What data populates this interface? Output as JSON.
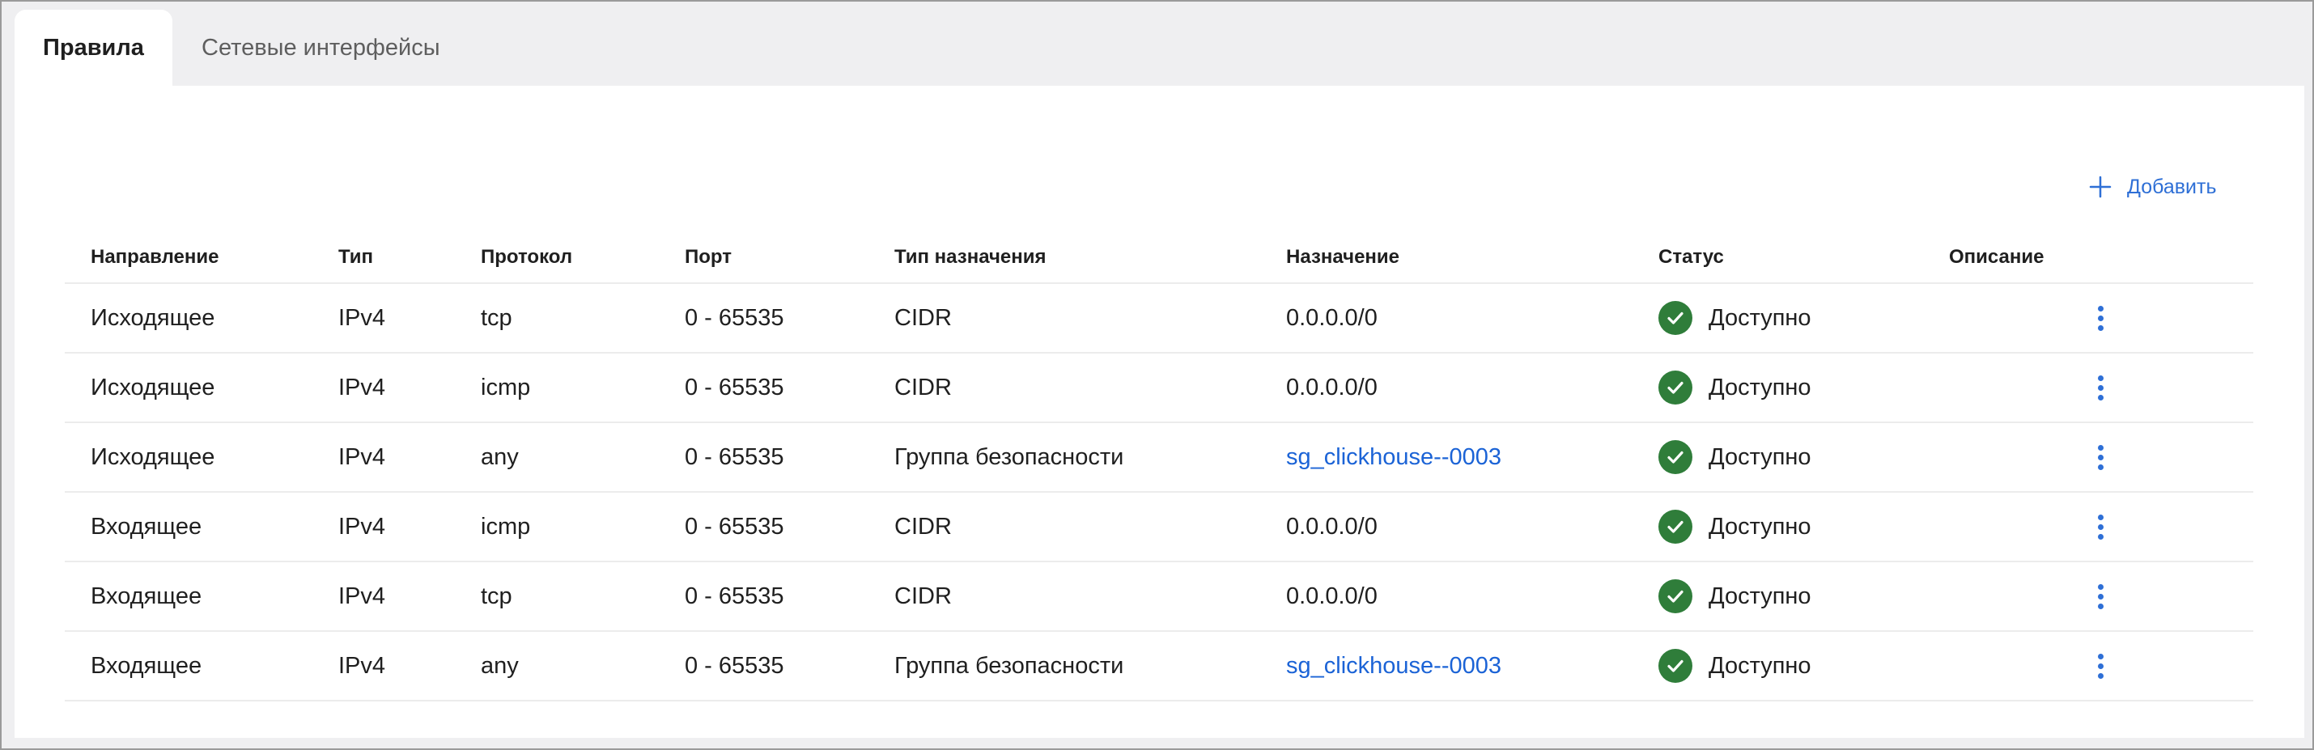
{
  "tabs": [
    {
      "label": "Правила",
      "active": true
    },
    {
      "label": "Сетевые интерфейсы",
      "active": false
    }
  ],
  "toolbar": {
    "add_label": "Добавить",
    "add_icon": "plus-icon"
  },
  "table": {
    "headers": [
      "Направление",
      "Тип",
      "Протокол",
      "Порт",
      "Тип назначения",
      "Назначение",
      "Статус",
      "Описание"
    ],
    "rows": [
      {
        "direction": "Исходящее",
        "type": "IPv4",
        "protocol": "tcp",
        "port": "0 - 65535",
        "dest_type": "CIDR",
        "dest": "0.0.0.0/0",
        "dest_is_link": false,
        "status": "Доступно",
        "description": ""
      },
      {
        "direction": "Исходящее",
        "type": "IPv4",
        "protocol": "icmp",
        "port": "0 - 65535",
        "dest_type": "CIDR",
        "dest": "0.0.0.0/0",
        "dest_is_link": false,
        "status": "Доступно",
        "description": ""
      },
      {
        "direction": "Исходящее",
        "type": "IPv4",
        "protocol": "any",
        "port": "0 - 65535",
        "dest_type": "Группа безопасности",
        "dest": "sg_clickhouse--0003",
        "dest_is_link": true,
        "status": "Доступно",
        "description": ""
      },
      {
        "direction": "Входящее",
        "type": "IPv4",
        "protocol": "icmp",
        "port": "0 - 65535",
        "dest_type": "CIDR",
        "dest": "0.0.0.0/0",
        "dest_is_link": false,
        "status": "Доступно",
        "description": ""
      },
      {
        "direction": "Входящее",
        "type": "IPv4",
        "protocol": "tcp",
        "port": "0 - 65535",
        "dest_type": "CIDR",
        "dest": "0.0.0.0/0",
        "dest_is_link": false,
        "status": "Доступно",
        "description": ""
      },
      {
        "direction": "Входящее",
        "type": "IPv4",
        "protocol": "any",
        "port": "0 - 65535",
        "dest_type": "Группа безопасности",
        "dest": "sg_clickhouse--0003",
        "dest_is_link": true,
        "status": "Доступно",
        "description": ""
      }
    ]
  },
  "colors": {
    "accent": "#2e6fd6",
    "link": "#1b63d6",
    "status_ok": "#2f7d3a"
  },
  "icons": {
    "status": "check-circle-icon",
    "row_menu": "more-vertical-icon"
  }
}
